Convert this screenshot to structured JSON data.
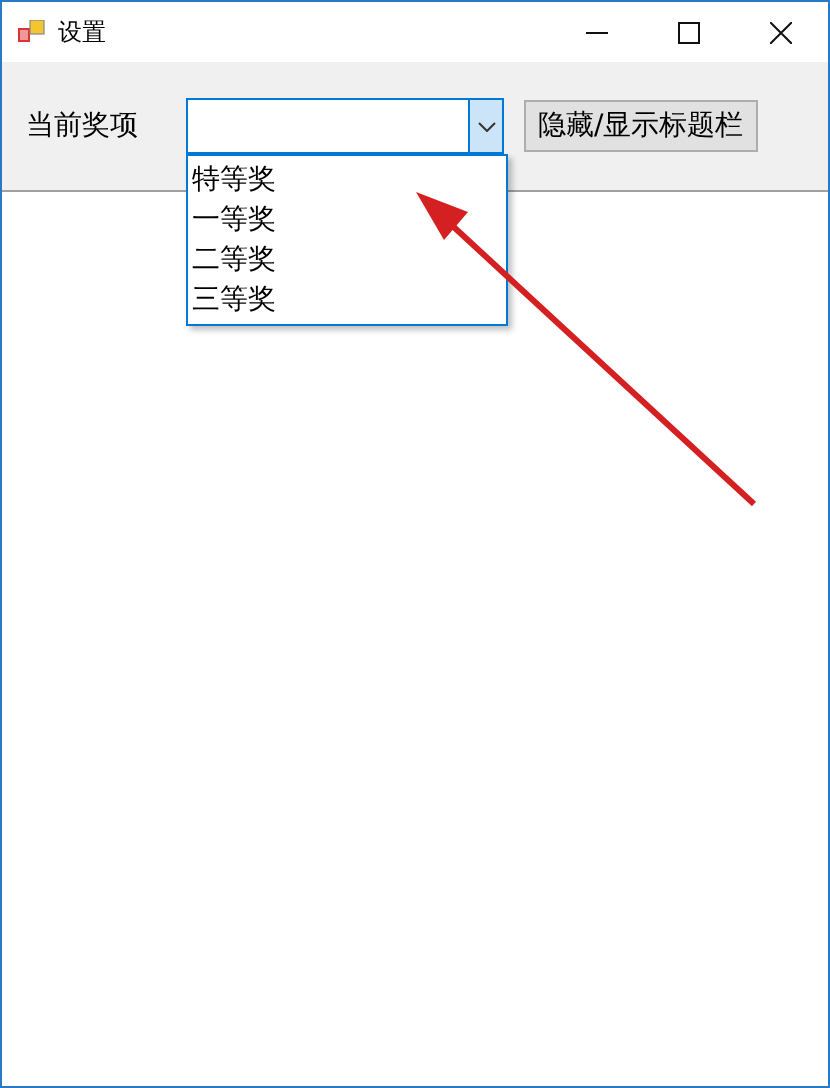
{
  "window": {
    "title": "设置"
  },
  "toolbar": {
    "label": "当前奖项",
    "combo": {
      "expanded": true,
      "options": [
        "特等奖",
        "一等奖",
        "二等奖",
        "三等奖"
      ]
    },
    "button": "隐藏/显示标题栏"
  },
  "annotation": {
    "kind": "arrow"
  }
}
